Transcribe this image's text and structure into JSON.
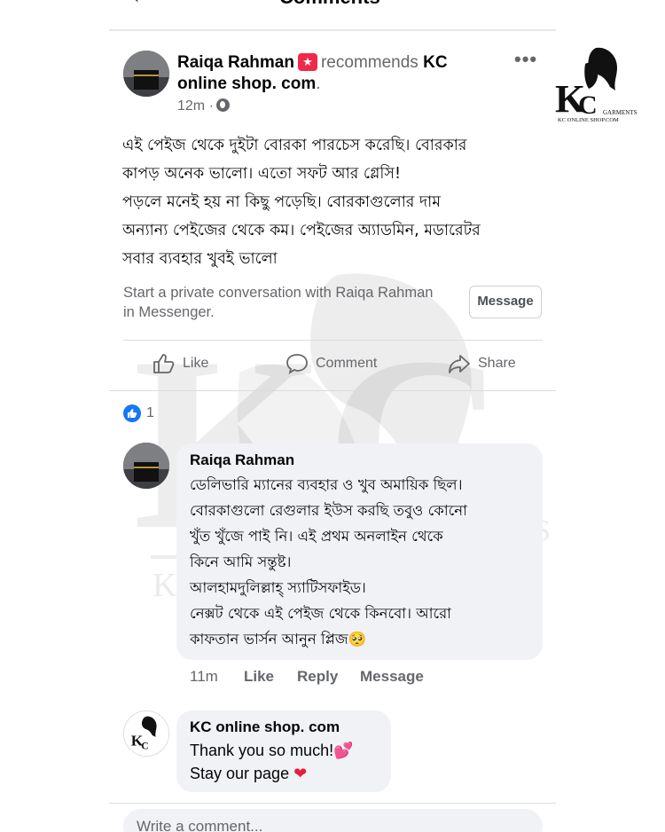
{
  "header": {
    "title": "Comments"
  },
  "post": {
    "author": "Raiqa Rahman",
    "recommends_text": "recommends",
    "page_name": "KC online shop. com",
    "period": ".",
    "time": "12m ·",
    "body": "এই পেইজ থেকে দুইটা বোরকা পারচেস করেছি। বোরকার\nকাপড় অনেক ভালো। এতো সফট আর গ্লেসি!\nপড়লে মনেই হয় না কিছু পড়েছি। বোরকাগুলোর দাম\nঅন্যান্য পেইজের থেকে কম। পেইজের অ্যাডমিন, মডারেটর\nসবার ব্যবহার খুবই ভালো",
    "private_text": "Start a private conversation with Raiqa Rahman in Messenger.",
    "message_button": "Message"
  },
  "logo": {
    "letter_k": "K",
    "letter_c": "C",
    "garments": "GARMENTS",
    "site": "KC ONLINE SHOP.COM"
  },
  "actions": {
    "like": "Like",
    "comment": "Comment",
    "share": "Share"
  },
  "reactions": {
    "count": "1"
  },
  "comment1": {
    "author": "Raiqa Rahman",
    "text": "ডেলিভারি ম্যানের ব্যবহার ও খুব অমায়িক ছিল।\nবোরকাগুলো রেগুলার ইউস করছি তবুও কোনো\nখুঁত খুঁজে পাই নি। এই প্রথম অনলাইন থেকে\nকিনে আমি সন্তুষ্ট।\nআলহামদুলিল্লাহ্ স্যাটিসফাইড।\nনেক্সট থেকে এই পেইজ থেকে কিনবো। আরো\nকাফতান ভার্সন আনুন প্লিজ🥺",
    "time": "11m",
    "like": "Like",
    "reply": "Reply",
    "message": "Message"
  },
  "comment2": {
    "author": "KC online shop. com",
    "line1": "Thank you so much!💕",
    "line2": "Stay our page",
    "heart": "❤"
  },
  "composer": {
    "placeholder": "Write a comment..."
  },
  "watermark": {
    "kc": "KC",
    "garments": "GARMENTS",
    "site": "KC ONLINE SHOP.COM"
  }
}
